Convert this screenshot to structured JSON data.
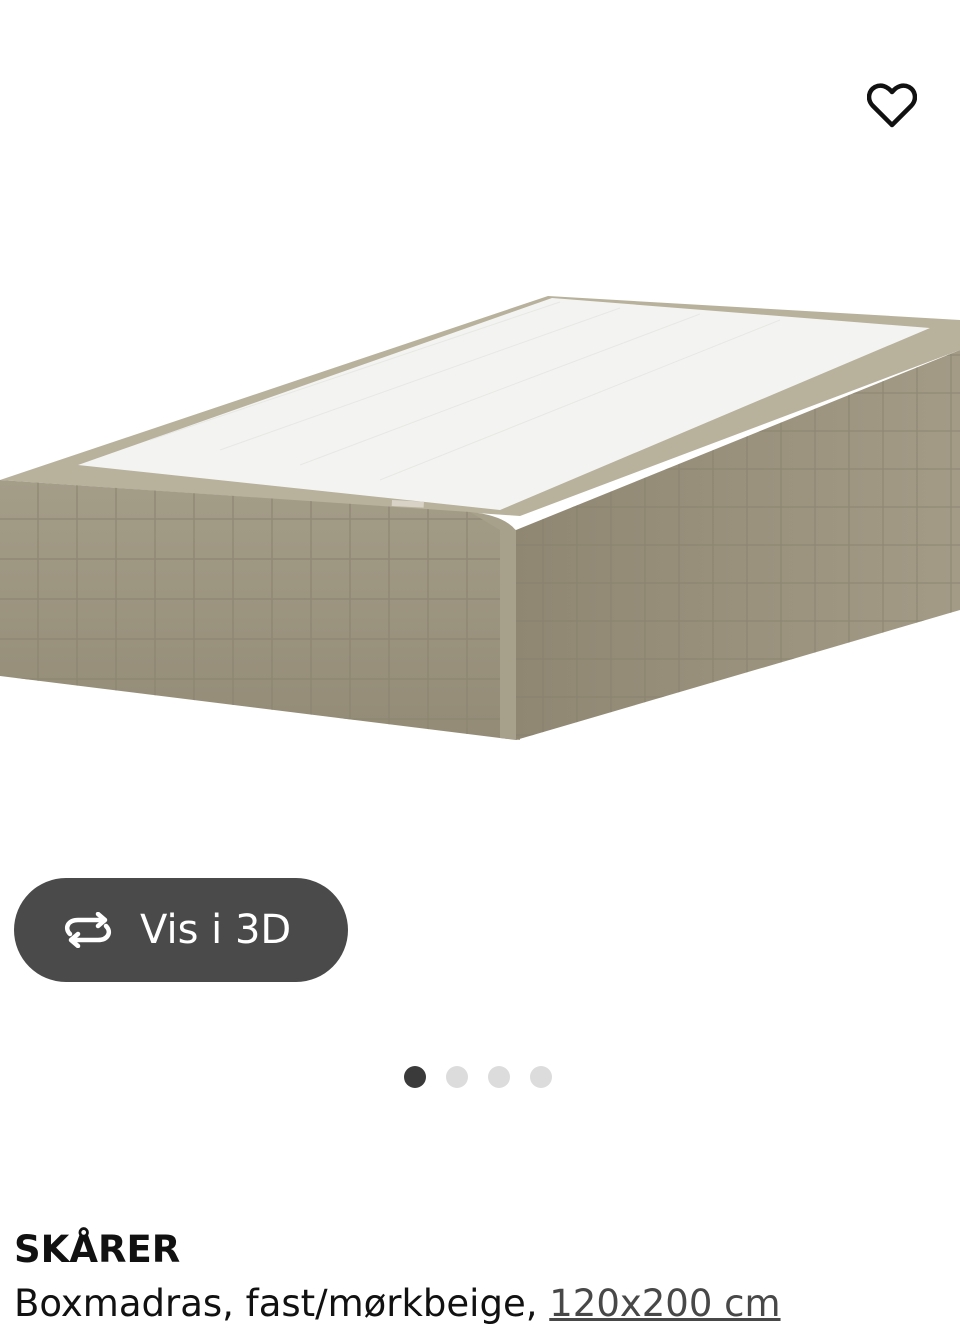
{
  "favorite": {
    "icon": "heart-outline-icon"
  },
  "gallery": {
    "view_3d_label": "Vis i 3D",
    "view_3d_icon": "rotate-3d-icon",
    "dots_count": 4,
    "active_dot": 1,
    "image_alt": "Boxmadras"
  },
  "product": {
    "name": "SKÅRER",
    "description": "Boxmadras, fast/mørkbeige, ",
    "size_link": "120x200 cm"
  },
  "colors": {
    "button_bg": "#4a4a4a",
    "dot_active": "#3a3a3a",
    "dot_inactive": "#dcdcdc",
    "fabric": "#9a927d",
    "top_sheet": "#f4f4f4"
  }
}
